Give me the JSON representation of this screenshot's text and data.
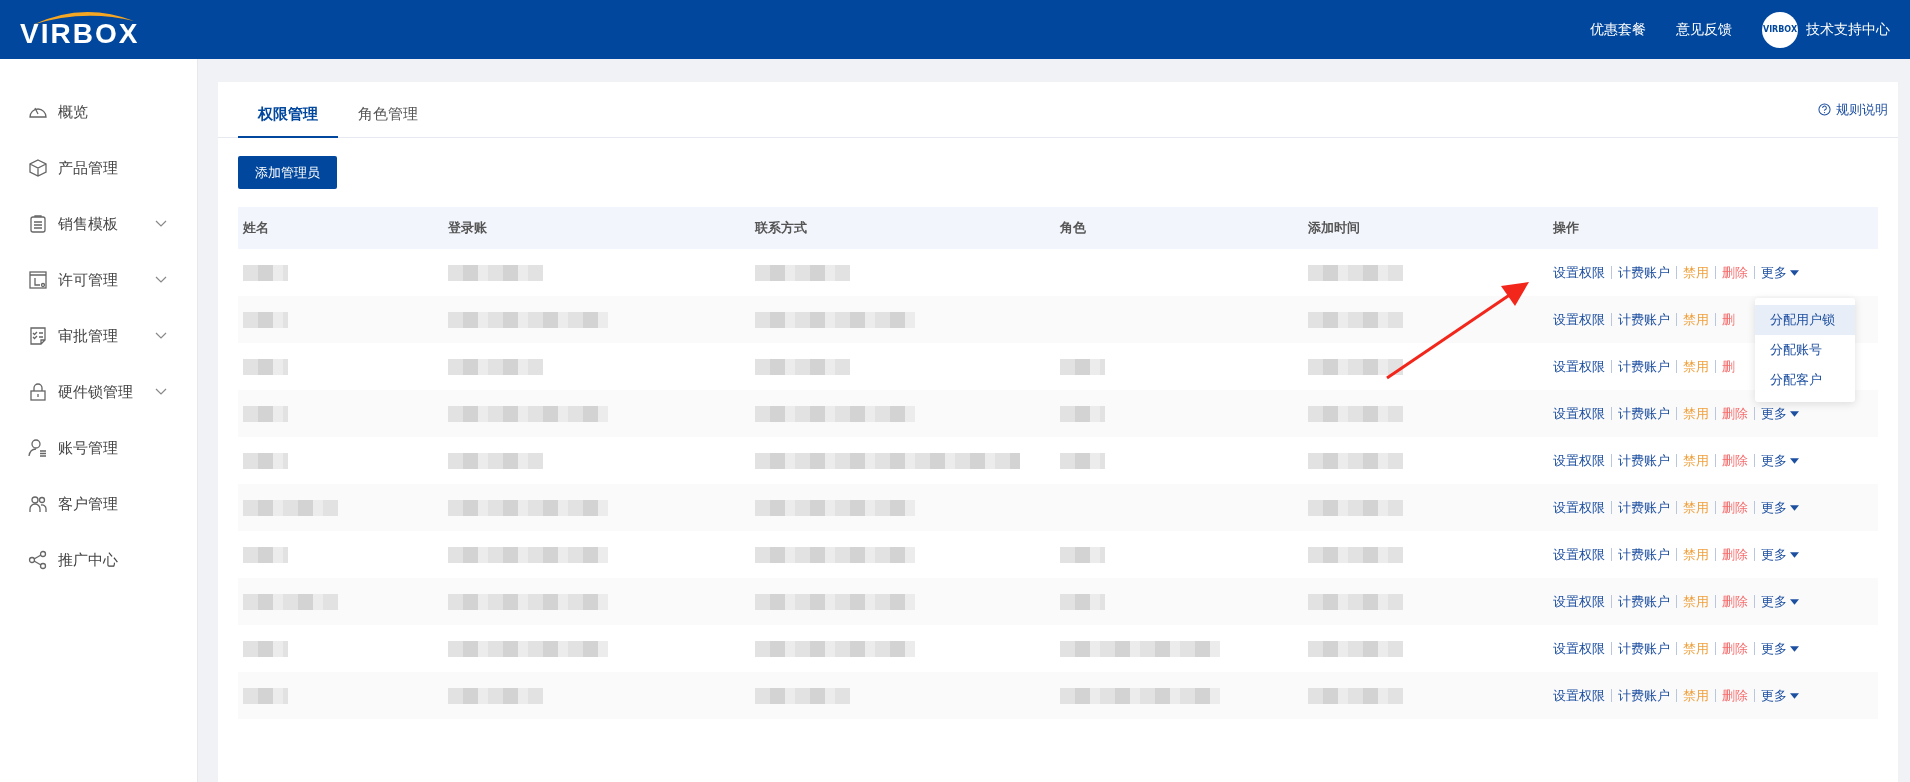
{
  "header": {
    "logo": "VIRBOX",
    "links": [
      "优惠套餐",
      "意见反馈"
    ],
    "avatar_text": "VIRBOX",
    "user": "技术支持中心"
  },
  "sidebar": {
    "items": [
      {
        "label": "概览",
        "expandable": false
      },
      {
        "label": "产品管理",
        "expandable": false
      },
      {
        "label": "销售模板",
        "expandable": true
      },
      {
        "label": "许可管理",
        "expandable": true
      },
      {
        "label": "审批管理",
        "expandable": true
      },
      {
        "label": "硬件锁管理",
        "expandable": true
      },
      {
        "label": "账号管理",
        "expandable": false
      },
      {
        "label": "客户管理",
        "expandable": false
      },
      {
        "label": "推广中心",
        "expandable": false
      }
    ]
  },
  "tabs": [
    {
      "label": "权限管理",
      "selected": true
    },
    {
      "label": "角色管理",
      "selected": false
    }
  ],
  "help_link": "规则说明",
  "add_button": "添加管理员",
  "table": {
    "columns": [
      "姓名",
      "登录账",
      "联系方式",
      "角色",
      "添加时间",
      "操作"
    ],
    "rows": [
      {
        "cells": [
          {
            "kind": "short"
          },
          {
            "kind": "medium"
          },
          {
            "kind": "medium"
          },
          {
            "kind": "empty"
          },
          {
            "kind": "medium"
          }
        ],
        "actions": [
          {
            "label": "设置权限",
            "kind": "link"
          },
          {
            "label": "计费账户",
            "kind": "link"
          },
          {
            "label": "禁用",
            "kind": "warn"
          },
          {
            "label": "删除",
            "kind": "danger"
          },
          {
            "label": "更多",
            "kind": "more"
          }
        ]
      },
      {
        "cells": [
          {
            "kind": "short"
          },
          {
            "kind": "long"
          },
          {
            "kind": "long"
          },
          {
            "kind": "empty"
          },
          {
            "kind": "medium"
          }
        ],
        "actions": [
          {
            "label": "设置权限",
            "kind": "link"
          },
          {
            "label": "计费账户",
            "kind": "link"
          },
          {
            "label": "禁用",
            "kind": "warn"
          },
          {
            "label": "删",
            "kind": "danger"
          }
        ]
      },
      {
        "cells": [
          {
            "kind": "short"
          },
          {
            "kind": "medium"
          },
          {
            "kind": "medium"
          },
          {
            "kind": "short"
          },
          {
            "kind": "medium"
          }
        ],
        "actions": [
          {
            "label": "设置权限",
            "kind": "link"
          },
          {
            "label": "计费账户",
            "kind": "link"
          },
          {
            "label": "禁用",
            "kind": "warn"
          },
          {
            "label": "删",
            "kind": "danger"
          }
        ]
      },
      {
        "cells": [
          {
            "kind": "short"
          },
          {
            "kind": "long"
          },
          {
            "kind": "long"
          },
          {
            "kind": "short"
          },
          {
            "kind": "medium"
          }
        ],
        "actions": [
          {
            "label": "设置权限",
            "kind": "link"
          },
          {
            "label": "计费账户",
            "kind": "link"
          },
          {
            "label": "禁用",
            "kind": "warn"
          },
          {
            "label": "删除",
            "kind": "danger"
          },
          {
            "label": "更多",
            "kind": "more"
          }
        ]
      },
      {
        "cells": [
          {
            "kind": "short"
          },
          {
            "kind": "medium"
          },
          {
            "kind": "xlong"
          },
          {
            "kind": "short"
          },
          {
            "kind": "medium"
          }
        ],
        "actions": [
          {
            "label": "设置权限",
            "kind": "link"
          },
          {
            "label": "计费账户",
            "kind": "link"
          },
          {
            "label": "禁用",
            "kind": "warn"
          },
          {
            "label": "删除",
            "kind": "danger"
          },
          {
            "label": "更多",
            "kind": "more"
          }
        ]
      },
      {
        "cells": [
          {
            "kind": "medium"
          },
          {
            "kind": "long"
          },
          {
            "kind": "long"
          },
          {
            "kind": "empty"
          },
          {
            "kind": "medium"
          }
        ],
        "actions": [
          {
            "label": "设置权限",
            "kind": "link"
          },
          {
            "label": "计费账户",
            "kind": "link"
          },
          {
            "label": "禁用",
            "kind": "warn"
          },
          {
            "label": "删除",
            "kind": "danger"
          },
          {
            "label": "更多",
            "kind": "more"
          }
        ]
      },
      {
        "cells": [
          {
            "kind": "short"
          },
          {
            "kind": "long"
          },
          {
            "kind": "long"
          },
          {
            "kind": "short"
          },
          {
            "kind": "medium"
          }
        ],
        "actions": [
          {
            "label": "设置权限",
            "kind": "link"
          },
          {
            "label": "计费账户",
            "kind": "link"
          },
          {
            "label": "禁用",
            "kind": "warn"
          },
          {
            "label": "删除",
            "kind": "danger"
          },
          {
            "label": "更多",
            "kind": "more"
          }
        ]
      },
      {
        "cells": [
          {
            "kind": "medium"
          },
          {
            "kind": "long"
          },
          {
            "kind": "long"
          },
          {
            "kind": "short"
          },
          {
            "kind": "medium"
          }
        ],
        "actions": [
          {
            "label": "设置权限",
            "kind": "link"
          },
          {
            "label": "计费账户",
            "kind": "link"
          },
          {
            "label": "禁用",
            "kind": "warn"
          },
          {
            "label": "删除",
            "kind": "danger"
          },
          {
            "label": "更多",
            "kind": "more"
          }
        ]
      },
      {
        "cells": [
          {
            "kind": "short"
          },
          {
            "kind": "long"
          },
          {
            "kind": "long"
          },
          {
            "kind": "long"
          },
          {
            "kind": "medium"
          }
        ],
        "actions": [
          {
            "label": "设置权限",
            "kind": "link"
          },
          {
            "label": "计费账户",
            "kind": "link"
          },
          {
            "label": "禁用",
            "kind": "warn"
          },
          {
            "label": "删除",
            "kind": "danger"
          },
          {
            "label": "更多",
            "kind": "more"
          }
        ]
      },
      {
        "cells": [
          {
            "kind": "short"
          },
          {
            "kind": "medium"
          },
          {
            "kind": "medium"
          },
          {
            "kind": "long"
          },
          {
            "kind": "medium"
          }
        ],
        "actions": [
          {
            "label": "设置权限",
            "kind": "link"
          },
          {
            "label": "计费账户",
            "kind": "link"
          },
          {
            "label": "禁用",
            "kind": "warn"
          },
          {
            "label": "删除",
            "kind": "danger"
          },
          {
            "label": "更多",
            "kind": "more"
          }
        ]
      }
    ]
  },
  "more_menu": {
    "items": [
      {
        "label": "分配用户锁",
        "selected": true
      },
      {
        "label": "分配账号",
        "selected": false
      },
      {
        "label": "分配客户",
        "selected": false
      }
    ]
  }
}
